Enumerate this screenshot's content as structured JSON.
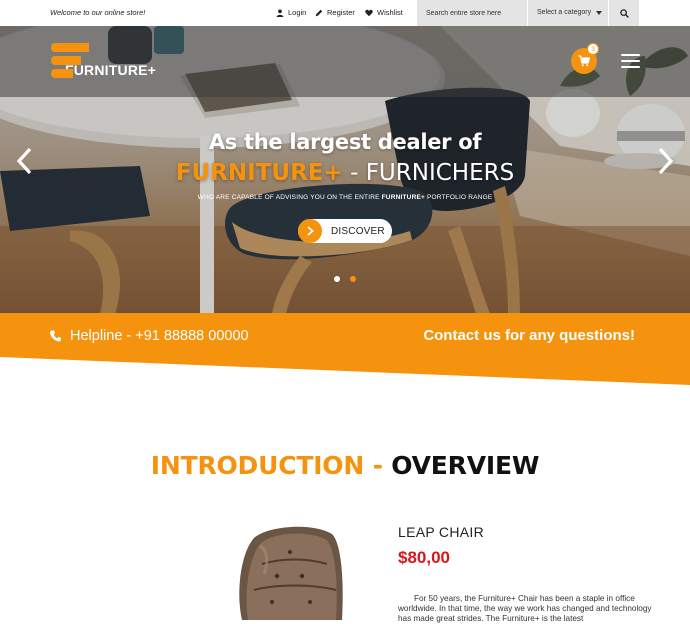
{
  "topbar": {
    "welcome": "Welcome to our online store!",
    "links": {
      "login": "Login",
      "register": "Register",
      "wishlist": "Wishlist"
    },
    "search_placeholder": "Search entire store here",
    "category_selected": "Select a category"
  },
  "header": {
    "logo_text": "FURNITURE+",
    "cart_count": "3"
  },
  "hero": {
    "title": "As the largest dealer of",
    "brand": "FURNITURE+",
    "dash": " - ",
    "subtitle": "FURNICHERS",
    "tagline_pre": "WHO ARE CAPABLE OF ADVISING YOU ON THE ENTIRE ",
    "tagline_brand": "FURNITURE+",
    "tagline_post": " PORTFOLIO RANGE",
    "button_label": "DISCOVER",
    "slide_count": 2,
    "active_slide": 2
  },
  "banner": {
    "helpline": "Helpline - +91 88888 00000",
    "contact": "Contact us for any questions!"
  },
  "intro": {
    "heading_a": "INTRODUCTION",
    "heading_b": " - ",
    "heading_c": "OVERVIEW"
  },
  "product": {
    "name": "LEAP CHAIR",
    "price": "$80,00",
    "description": "For 50 years, the Furniture+ Chair has been a staple in office worldwide. In that time, the way we work has changed and technology has made great strides. The Furniture+ is the latest"
  },
  "colors": {
    "accent": "#f5930e",
    "price": "#d7161b"
  },
  "icons": [
    "user-icon",
    "pencil-icon",
    "heart-icon",
    "search-icon",
    "cart-icon",
    "menu-icon",
    "chevron-left-icon",
    "chevron-right-icon",
    "arrow-right-icon",
    "phone-icon"
  ]
}
